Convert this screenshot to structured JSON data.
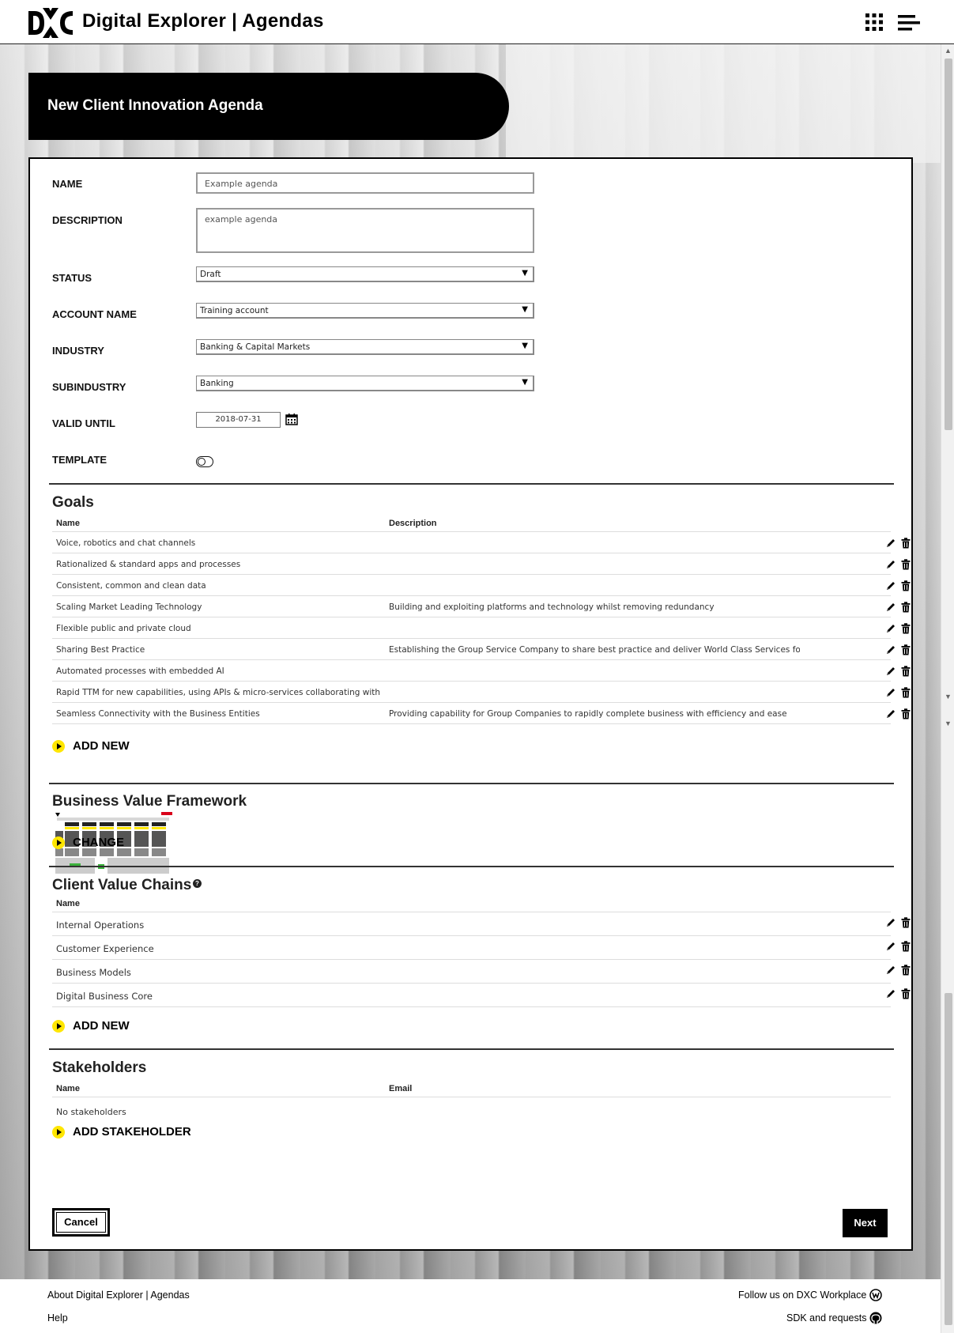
{
  "header": {
    "app_title": "Digital Explorer | Agendas"
  },
  "banner": {
    "title": "New Client Innovation Agenda"
  },
  "form": {
    "name_label": "NAME",
    "name_value": "Example agenda",
    "description_label": "DESCRIPTION",
    "description_value": "example agenda",
    "status_label": "STATUS",
    "status_value": "Draft",
    "account_label": "ACCOUNT NAME",
    "account_value": "Training account",
    "industry_label": "INDUSTRY",
    "industry_value": "Banking & Capital Markets",
    "subindustry_label": "SUBINDUSTRY",
    "subindustry_value": "Banking",
    "valid_until_label": "VALID UNTIL",
    "valid_until_value": "2018-07-31",
    "template_label": "TEMPLATE"
  },
  "goals": {
    "title": "Goals",
    "col_name": "Name",
    "col_description": "Description",
    "rows": [
      {
        "name": "Voice, robotics and chat channels",
        "description": ""
      },
      {
        "name": "Rationalized & standard apps and processes",
        "description": ""
      },
      {
        "name": "Consistent, common and clean data",
        "description": ""
      },
      {
        "name": "Scaling Market Leading Technology",
        "description": "Building and exploiting platforms and technology whilst removing redundancy"
      },
      {
        "name": "Flexible public and private cloud",
        "description": ""
      },
      {
        "name": "Sharing Best Practice",
        "description": "Establishing the Group Service Company to share best practice and deliver World Class Services for cu"
      },
      {
        "name": "Automated processes with embedded AI",
        "description": ""
      },
      {
        "name": "Rapid TTM for new capabilities, using APIs & micro-services collaborating with Fint",
        "description": ""
      },
      {
        "name": "Seamless Connectivity with the Business Entities",
        "description": "Providing capability for Group Companies to rapidly complete business with efficiency and ease"
      }
    ],
    "add_label": "ADD NEW"
  },
  "bvf": {
    "title": "Business Value Framework",
    "change_label": "CHANGE"
  },
  "value_chains": {
    "title": "Client Value Chains",
    "col_name": "Name",
    "rows": [
      {
        "name": "Internal Operations"
      },
      {
        "name": "Customer Experience"
      },
      {
        "name": "Business Models"
      },
      {
        "name": "Digital Business Core"
      }
    ],
    "add_label": "ADD NEW"
  },
  "stakeholders": {
    "title": "Stakeholders",
    "col_name": "Name",
    "col_email": "Email",
    "empty_text": "No stakeholders",
    "add_label": "ADD STAKEHOLDER"
  },
  "buttons": {
    "cancel": "Cancel",
    "next": "Next"
  },
  "footer": {
    "about": "About Digital Explorer | Agendas",
    "help": "Help",
    "follow": "Follow us on DXC Workplace",
    "sdk": "SDK and requests"
  },
  "colors": {
    "accent": "#ffe600",
    "black": "#000000"
  }
}
